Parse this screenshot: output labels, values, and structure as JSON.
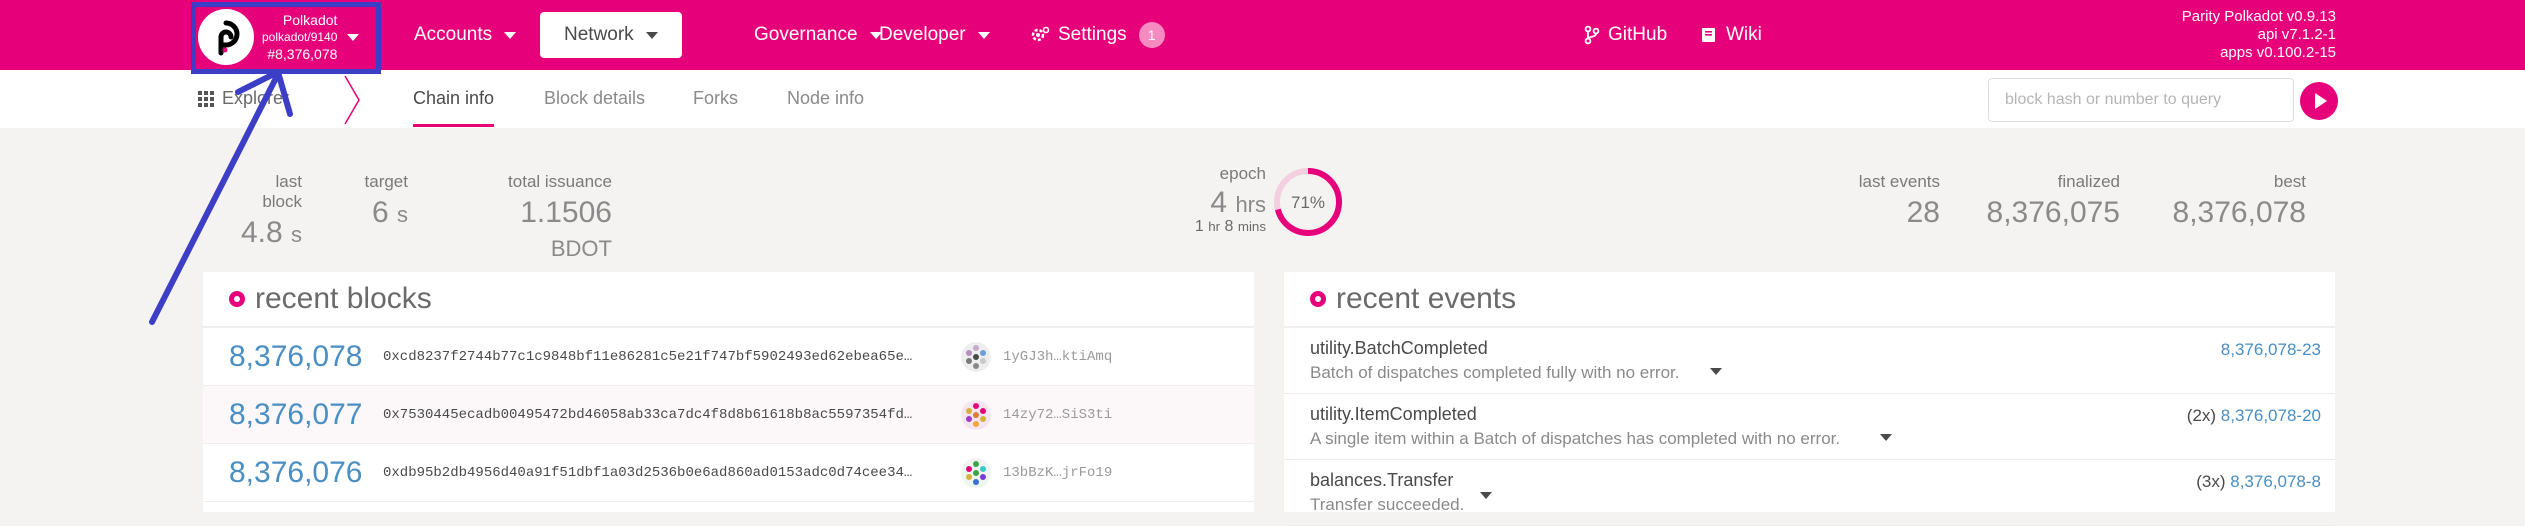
{
  "chain": {
    "name": "Polkadot",
    "runtime": "polkadot/9140",
    "block": "#8,376,078"
  },
  "nav": {
    "accounts": "Accounts",
    "network": "Network",
    "governance": "Governance",
    "developer": "Developer",
    "settings": "Settings",
    "settings_badge": "1",
    "github": "GitHub",
    "wiki": "Wiki"
  },
  "versions": {
    "node": "Parity Polkadot v0.9.13",
    "api": "api v7.1.2-1",
    "apps": "apps v0.100.2-15"
  },
  "subnav": {
    "section": "Explorer",
    "tabs": [
      "Chain info",
      "Block details",
      "Forks",
      "Node info"
    ],
    "search_placeholder": "block hash or number to query"
  },
  "stats": {
    "last_block_label": "last block",
    "last_block_value": "4.8",
    "last_block_unit": "s",
    "target_label": "target",
    "target_value": "6",
    "target_unit": "s",
    "issuance_label": "total issuance",
    "issuance_int": "1.",
    "issuance_value": "1506",
    "issuance_unit": "BDOT",
    "epoch_label": "epoch",
    "epoch_value": "4",
    "epoch_unit": "hrs",
    "epoch_sub_h": "1",
    "epoch_sub_hr": "hr",
    "epoch_sub_m": "8",
    "epoch_sub_mins": "mins",
    "epoch_pct": "71%",
    "epoch_fraction": 0.71,
    "last_events_label": "last events",
    "last_events_value": "28",
    "finalized_label": "finalized",
    "finalized_value": "8,376,075",
    "best_label": "best",
    "best_value": "8,376,078"
  },
  "recent_blocks": {
    "title": "recent blocks",
    "rows": [
      {
        "number": "8,376,078",
        "hash": "0xcd8237f2744b77c1c9848bf11e86281c5e21f747bf5902493ed62ebea65e…",
        "author": "1yGJ3h…ktiAmq"
      },
      {
        "number": "8,376,077",
        "hash": "0x7530445ecadb00495472bd46058ab33ca7dc4f8d8b61618b8ac5597354fd…",
        "author": "14zy72…SiS3ti"
      },
      {
        "number": "8,376,076",
        "hash": "0xdb95b2db4956d40a91f51dbf1a03d2536b0e6ad860ad0153adc0d74cee34…",
        "author": "13bBzK…jrFo19"
      }
    ]
  },
  "recent_events": {
    "title": "recent events",
    "rows": [
      {
        "name": "utility.BatchCompleted",
        "desc": "Batch of dispatches completed fully with no error.",
        "count": "",
        "ref": "8,376,078-23"
      },
      {
        "name": "utility.ItemCompleted",
        "desc": "A single item within a Batch of dispatches has completed with no error.",
        "count": "(2x)",
        "ref": "8,376,078-20"
      },
      {
        "name": "balances.Transfer",
        "desc": "Transfer succeeded.",
        "count": "(3x)",
        "ref": "8,376,078-8"
      }
    ]
  },
  "colors": {
    "brand": "#e6007a",
    "annotation": "#3c3ec6",
    "link": "#4a8ec2"
  }
}
